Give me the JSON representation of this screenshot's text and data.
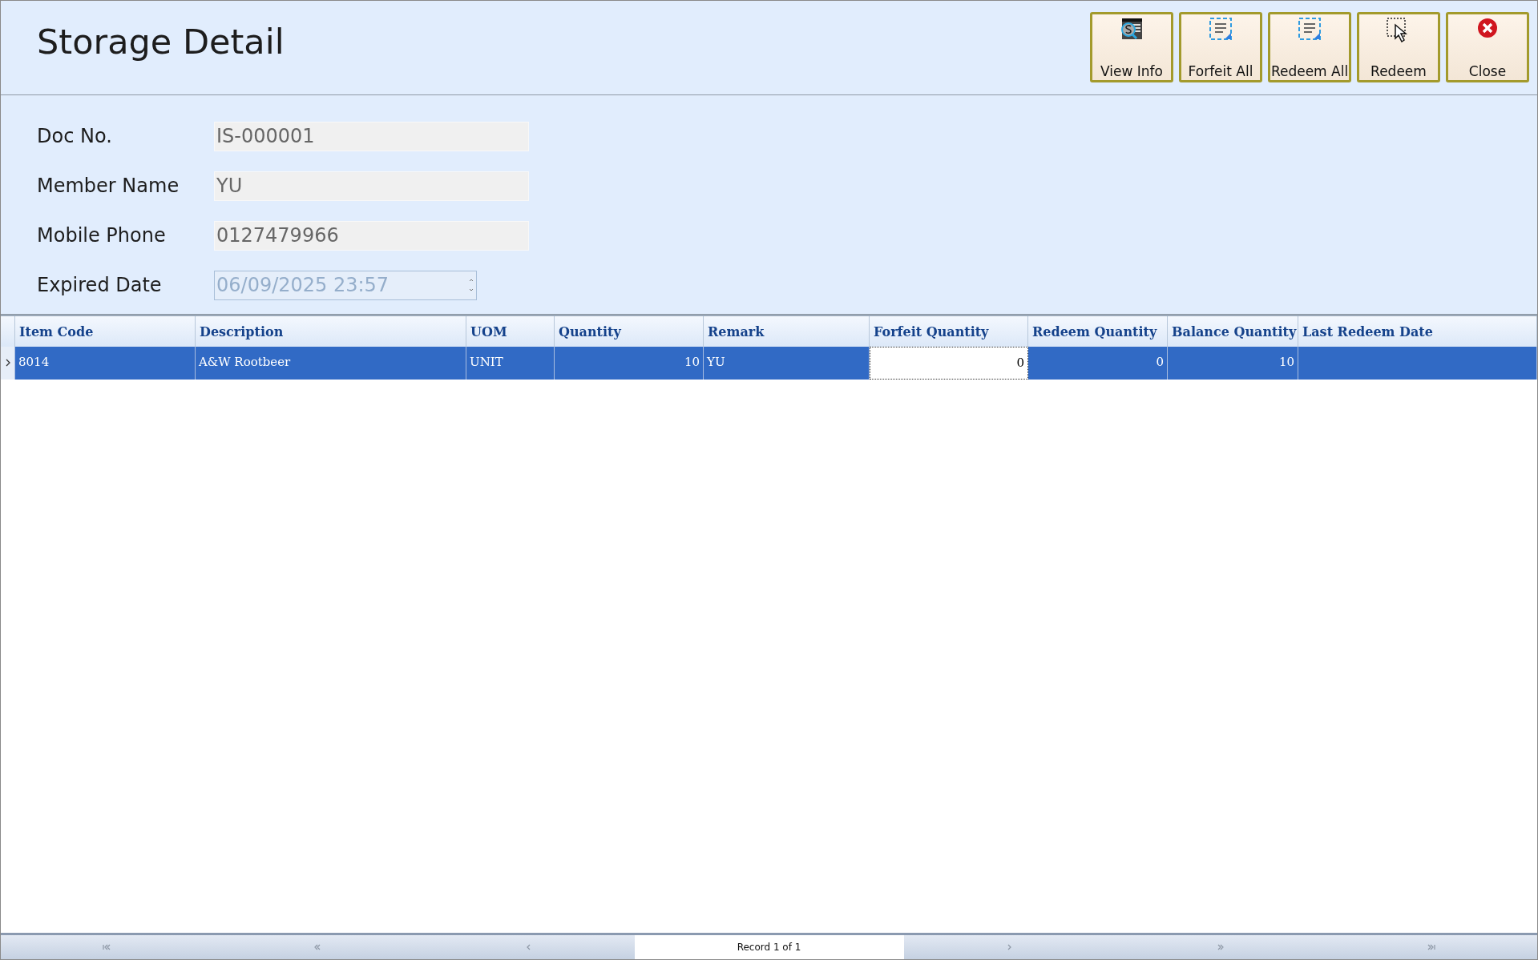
{
  "window": {
    "title": "Storage Detail"
  },
  "toolbar": [
    {
      "label": "View Info",
      "kind": "view"
    },
    {
      "label": "Forfeit All",
      "kind": "select_all"
    },
    {
      "label": "Redeem All",
      "kind": "select_all"
    },
    {
      "label": "Redeem",
      "kind": "pointer"
    },
    {
      "label": "Close",
      "kind": "close"
    }
  ],
  "form": [
    {
      "label": "Doc No.",
      "value": "IS-000001",
      "kind": "text"
    },
    {
      "label": "Member Name",
      "value": "YU",
      "kind": "text"
    },
    {
      "label": "Mobile Phone",
      "value": "0127479966",
      "kind": "text"
    },
    {
      "label": "Expired Date",
      "value": "06/09/2025 23:57",
      "kind": "datetime"
    }
  ],
  "table": {
    "columns": [
      {
        "label": "Item Code",
        "kind": "text"
      },
      {
        "label": "Description",
        "kind": "text"
      },
      {
        "label": "UOM",
        "kind": "text"
      },
      {
        "label": "Quantity",
        "kind": "number"
      },
      {
        "label": "Remark",
        "kind": "text"
      },
      {
        "label": "Forfeit Quantity",
        "kind": "number"
      },
      {
        "label": "Redeem Quantity",
        "kind": "number"
      },
      {
        "label": "Balance Quantity",
        "kind": "number"
      },
      {
        "label": "Last Redeem Date",
        "kind": "text"
      }
    ],
    "rows": [
      {
        "selected": true,
        "cells": [
          {
            "text": "8014",
            "focused": false
          },
          {
            "text": "A&W Rootbeer",
            "focused": false
          },
          {
            "text": "UNIT",
            "focused": false
          },
          {
            "text": "10",
            "focused": false
          },
          {
            "text": "YU",
            "focused": false
          },
          {
            "text": "0",
            "focused": true
          },
          {
            "text": "0",
            "focused": false
          },
          {
            "text": "10",
            "focused": false
          },
          {
            "focused": false
          }
        ]
      }
    ]
  },
  "navigator": {
    "record_text": "Record 1 of 1"
  }
}
